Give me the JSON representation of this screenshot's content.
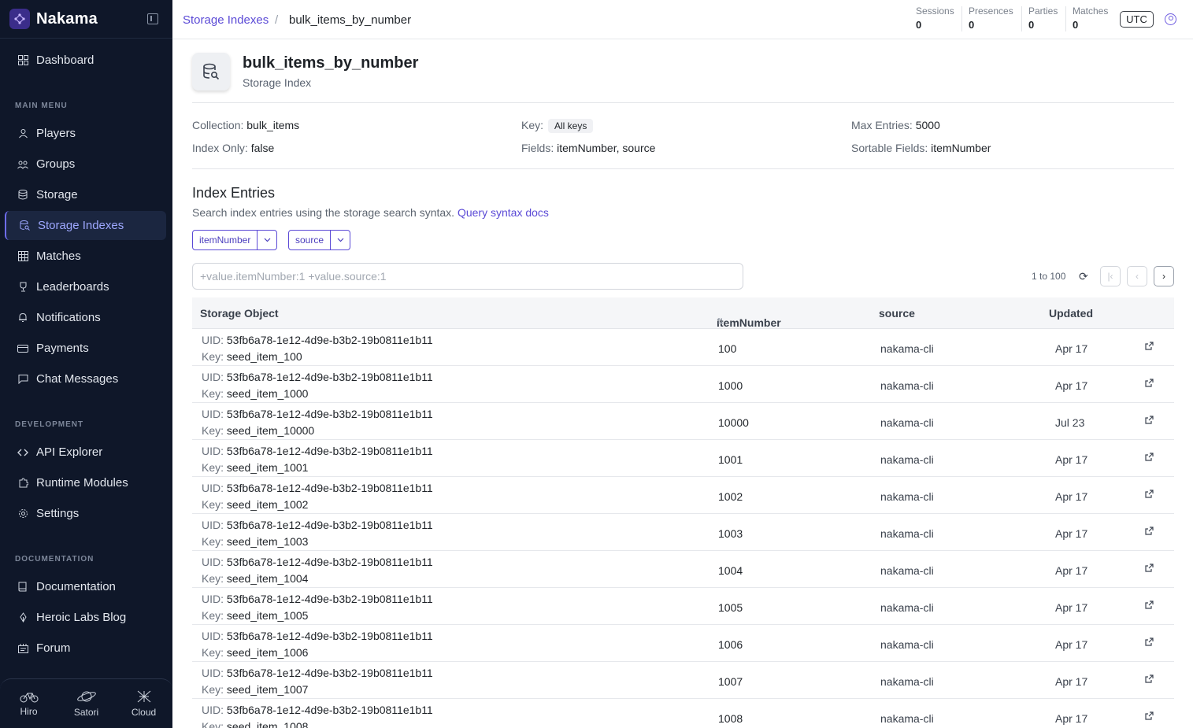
{
  "app": {
    "name": "Nakama"
  },
  "sidebar": {
    "dashboard": "Dashboard",
    "main_menu_label": "MAIN MENU",
    "main_items": [
      {
        "label": "Players",
        "icon": "user-icon"
      },
      {
        "label": "Groups",
        "icon": "users-icon"
      },
      {
        "label": "Storage",
        "icon": "database-icon"
      },
      {
        "label": "Storage Indexes",
        "icon": "database-search-icon",
        "active": true
      },
      {
        "label": "Matches",
        "icon": "grid-icon"
      },
      {
        "label": "Leaderboards",
        "icon": "trophy-icon"
      },
      {
        "label": "Notifications",
        "icon": "bell-icon"
      },
      {
        "label": "Payments",
        "icon": "card-icon"
      },
      {
        "label": "Chat Messages",
        "icon": "chat-icon"
      }
    ],
    "development_label": "DEVELOPMENT",
    "dev_items": [
      {
        "label": "API Explorer",
        "icon": "code-icon"
      },
      {
        "label": "Runtime Modules",
        "icon": "puzzle-icon"
      },
      {
        "label": "Settings",
        "icon": "gear-icon"
      }
    ],
    "documentation_label": "DOCUMENTATION",
    "doc_items": [
      {
        "label": "Documentation",
        "icon": "book-icon"
      },
      {
        "label": "Heroic Labs Blog",
        "icon": "pen-icon"
      },
      {
        "label": "Forum",
        "icon": "forum-icon"
      }
    ],
    "bottom": [
      {
        "label": "Hiro",
        "icon": "bike-icon"
      },
      {
        "label": "Satori",
        "icon": "planet-icon"
      },
      {
        "label": "Cloud",
        "icon": "cloud-icon"
      }
    ]
  },
  "header": {
    "breadcrumb_link": "Storage Indexes",
    "breadcrumb_sep": "/",
    "breadcrumb_current": "bulk_items_by_number",
    "stats": [
      {
        "label": "Sessions",
        "value": "0"
      },
      {
        "label": "Presences",
        "value": "0"
      },
      {
        "label": "Parties",
        "value": "0"
      },
      {
        "label": "Matches",
        "value": "0"
      }
    ],
    "timezone": "UTC"
  },
  "page": {
    "title": "bulk_items_by_number",
    "subtitle": "Storage Index",
    "details": {
      "collection_label": "Collection:",
      "collection": "bulk_items",
      "key_label": "Key:",
      "key": "All keys",
      "max_entries_label": "Max Entries:",
      "max_entries": "5000",
      "index_only_label": "Index Only:",
      "index_only": "false",
      "fields_label": "Fields:",
      "fields": "itemNumber, source",
      "sortable_label": "Sortable Fields:",
      "sortable": "itemNumber"
    },
    "entries_title": "Index Entries",
    "entries_desc": "Search index entries using the storage search syntax.",
    "entries_link": "Query syntax docs",
    "chips": [
      "itemNumber",
      "source"
    ],
    "search_placeholder": "+value.itemNumber:1 +value.source:1",
    "range": "1 to 100"
  },
  "table": {
    "columns": [
      "Storage Object",
      "itemNumber",
      "source",
      "Updated"
    ],
    "uid_label": "UID:",
    "key_label": "Key:",
    "rows": [
      {
        "uid": "53fb6a78-1e12-4d9e-b3b2-19b0811e1b11",
        "key": "seed_item_100",
        "itemNumber": "100",
        "source": "nakama-cli",
        "updated": "Apr 17"
      },
      {
        "uid": "53fb6a78-1e12-4d9e-b3b2-19b0811e1b11",
        "key": "seed_item_1000",
        "itemNumber": "1000",
        "source": "nakama-cli",
        "updated": "Apr 17"
      },
      {
        "uid": "53fb6a78-1e12-4d9e-b3b2-19b0811e1b11",
        "key": "seed_item_10000",
        "itemNumber": "10000",
        "source": "nakama-cli",
        "updated": "Jul 23"
      },
      {
        "uid": "53fb6a78-1e12-4d9e-b3b2-19b0811e1b11",
        "key": "seed_item_1001",
        "itemNumber": "1001",
        "source": "nakama-cli",
        "updated": "Apr 17"
      },
      {
        "uid": "53fb6a78-1e12-4d9e-b3b2-19b0811e1b11",
        "key": "seed_item_1002",
        "itemNumber": "1002",
        "source": "nakama-cli",
        "updated": "Apr 17"
      },
      {
        "uid": "53fb6a78-1e12-4d9e-b3b2-19b0811e1b11",
        "key": "seed_item_1003",
        "itemNumber": "1003",
        "source": "nakama-cli",
        "updated": "Apr 17"
      },
      {
        "uid": "53fb6a78-1e12-4d9e-b3b2-19b0811e1b11",
        "key": "seed_item_1004",
        "itemNumber": "1004",
        "source": "nakama-cli",
        "updated": "Apr 17"
      },
      {
        "uid": "53fb6a78-1e12-4d9e-b3b2-19b0811e1b11",
        "key": "seed_item_1005",
        "itemNumber": "1005",
        "source": "nakama-cli",
        "updated": "Apr 17"
      },
      {
        "uid": "53fb6a78-1e12-4d9e-b3b2-19b0811e1b11",
        "key": "seed_item_1006",
        "itemNumber": "1006",
        "source": "nakama-cli",
        "updated": "Apr 17"
      },
      {
        "uid": "53fb6a78-1e12-4d9e-b3b2-19b0811e1b11",
        "key": "seed_item_1007",
        "itemNumber": "1007",
        "source": "nakama-cli",
        "updated": "Apr 17"
      },
      {
        "uid": "53fb6a78-1e12-4d9e-b3b2-19b0811e1b11",
        "key": "seed_item_1008",
        "itemNumber": "1008",
        "source": "nakama-cli",
        "updated": "Apr 17"
      }
    ]
  },
  "colors": {
    "accent": "#5b4ad6",
    "sidebar_bg": "#0f1729"
  }
}
